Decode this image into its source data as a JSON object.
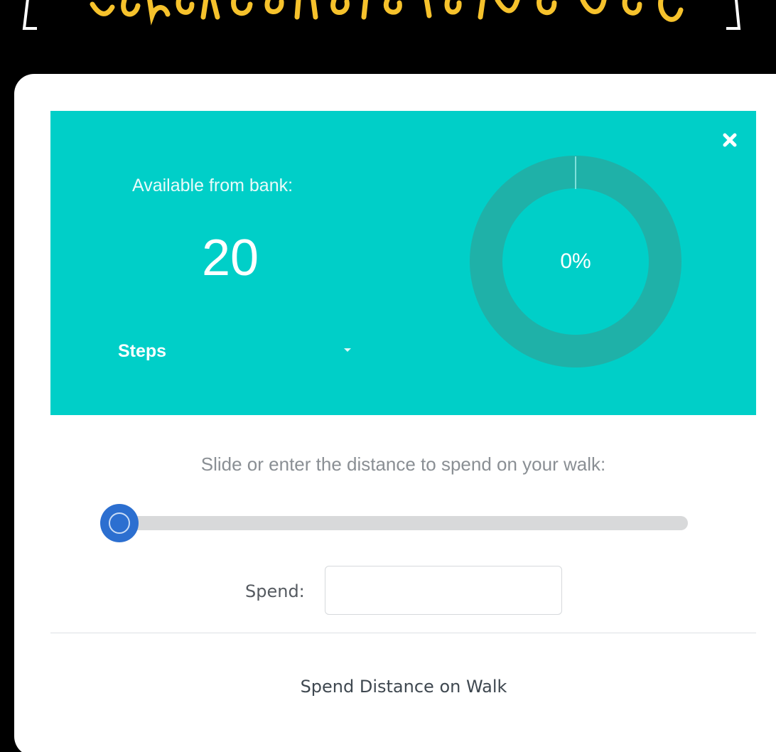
{
  "modal": {
    "close_glyph": "✕",
    "bank_label": "Available from bank:",
    "bank_value": "20",
    "unit_selected": "Steps",
    "progress_percent": 0,
    "progress_label": "0%",
    "instruction": "Slide or enter the distance to spend on your walk:",
    "slider_value_fraction": 0,
    "spend_label": "Spend:",
    "spend_value": "",
    "spend_placeholder": "",
    "submit_label": "Spend Distance on Walk"
  },
  "colors": {
    "banner_text": "#f6c22c",
    "panel": "#00cfc8",
    "donut_ring": "#1fb1a8",
    "slider_thumb": "#2c6fd0",
    "slider_track": "#d8d9da"
  },
  "icons": {
    "close": "close-icon",
    "dropdown": "caret-down-icon"
  }
}
